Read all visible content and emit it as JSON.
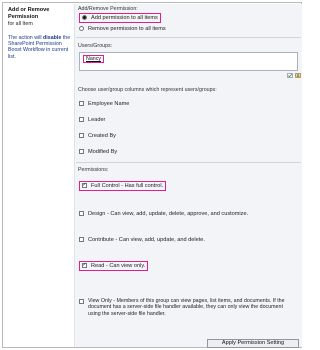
{
  "left": {
    "title": "Add or Remove Permission",
    "description": "for all Item",
    "note_prefix": "The action will ",
    "note_bold": "disable",
    "note_suffix": " the SharePoint Permission Boost Workflow in current list."
  },
  "permission_mode": {
    "label": "Add/Remove Permission:",
    "options": [
      "Add permission to all items",
      "Remove permission to all items"
    ],
    "selected": "Add permission to all items"
  },
  "users": {
    "label": "Users/Groups:",
    "value": "Nancy"
  },
  "columns": {
    "label": "Choose user/group columns which represent users/groups:",
    "items": [
      {
        "label": "Employee Name",
        "checked": false
      },
      {
        "label": "Leader",
        "checked": false
      },
      {
        "label": "Created By",
        "checked": false
      },
      {
        "label": "Modified By",
        "checked": false
      }
    ]
  },
  "permissions": {
    "label": "Permissions:",
    "items": [
      {
        "label": "Full Control - Has full control.",
        "checked": true
      },
      {
        "label": "Design - Can view, add, update, delete, approve, and customize.",
        "checked": false
      },
      {
        "label": "Contribute - Can view, add, update, and delete.",
        "checked": false
      },
      {
        "label": "Read - Can view only.",
        "checked": true
      },
      {
        "label": "View Only - Members of this group can view pages, list items, and documents. If the document has a server-side file handler available, they can only view the document using the server-side file handler.",
        "checked": false
      }
    ]
  },
  "apply_button": "Apply Permission Setting",
  "icons": [
    "check-names-icon",
    "address-book-icon"
  ],
  "colors": {
    "highlight": "#e0208a",
    "panel": "#f2f4f7",
    "note_text": "#1a3b8a"
  }
}
